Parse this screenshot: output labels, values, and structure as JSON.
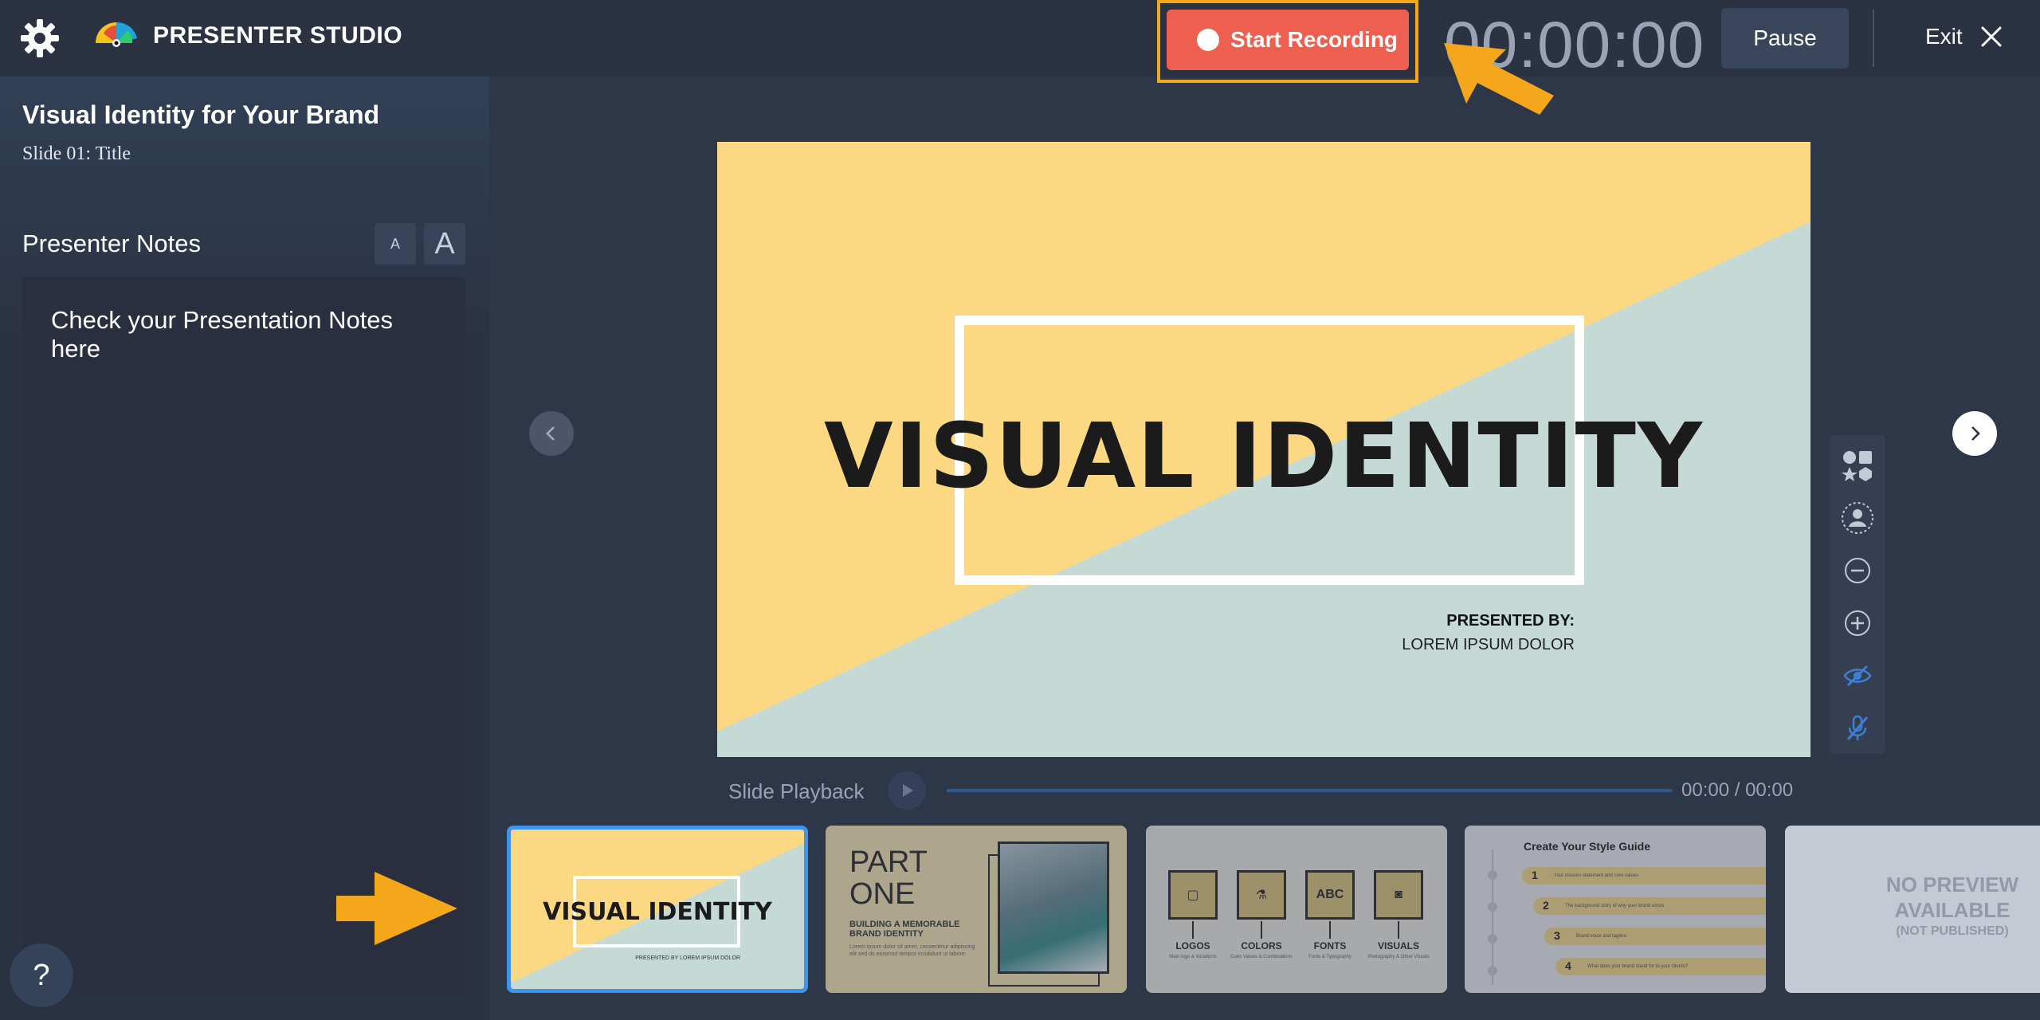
{
  "app": {
    "brand_name": "PRESENTER STUDIO",
    "accent": "#ef5f50",
    "highlight": "#f5a71b"
  },
  "toolbar": {
    "record_label": "Start Recording",
    "timer": "00:00:00",
    "pause_label": "Pause",
    "exit_label": "Exit",
    "icons": [
      "gear-icon",
      "record-dot-icon",
      "close-icon"
    ]
  },
  "sidebar": {
    "deck_title": "Visual Identity for Your Brand",
    "slide_label": "Slide 01: Title",
    "notes_label": "Presenter Notes",
    "font_small": "A",
    "font_large": "A",
    "notes_text": "Check your Presentation Notes here",
    "help": "?"
  },
  "slide": {
    "title": "VISUAL IDENTITY",
    "presented_by": "PRESENTED BY:",
    "presenter": "LOREM IPSUM DOLOR",
    "colors": {
      "yellow": "#fdd882",
      "teal": "#c5d9d5"
    }
  },
  "playback": {
    "label": "Slide Playback",
    "time": "00:00 / 00:00"
  },
  "tools": [
    "shapes-icon",
    "avatar-icon",
    "zoom-out-icon",
    "zoom-in-icon",
    "hide-icon",
    "mic-off-icon"
  ],
  "thumbnails": {
    "t1": {
      "title": "VISUAL IDENTITY",
      "small": "PRESENTED BY\nLOREM IPSUM DOLOR"
    },
    "t2": {
      "part_line1": "PART",
      "part_line2": "ONE",
      "subtitle": "BUILDING A MEMORABLE BRAND IDENTITY",
      "body": "Lorem ipsum dolor sit amet, consectetur adipiscing elit sed do eiusmod tempor incididunt ut labore."
    },
    "t3": {
      "items": [
        {
          "label": "LOGOS",
          "desc": "Main logo & Variations",
          "glyph": "▢"
        },
        {
          "label": "COLORS",
          "desc": "Color Values & Combinations",
          "glyph": "⚗"
        },
        {
          "label": "FONTS",
          "desc": "Fonts & Typography",
          "glyph": "ABC"
        },
        {
          "label": "VISUALS",
          "desc": "Photography & Other Visuals",
          "glyph": "◙"
        }
      ]
    },
    "t4": {
      "title": "Create Your Style Guide",
      "steps": [
        {
          "num": "1",
          "text": "Your mission statement and core values"
        },
        {
          "num": "2",
          "text": "The background story of why your brand exists"
        },
        {
          "num": "3",
          "text": "Brand voice and tagline"
        },
        {
          "num": "4",
          "text": "What does your brand stand for to your clients?"
        }
      ]
    },
    "t5": {
      "line1": "NO PREVIEW",
      "line2": "AVAILABLE",
      "sub": "(NOT PUBLISHED)"
    }
  }
}
